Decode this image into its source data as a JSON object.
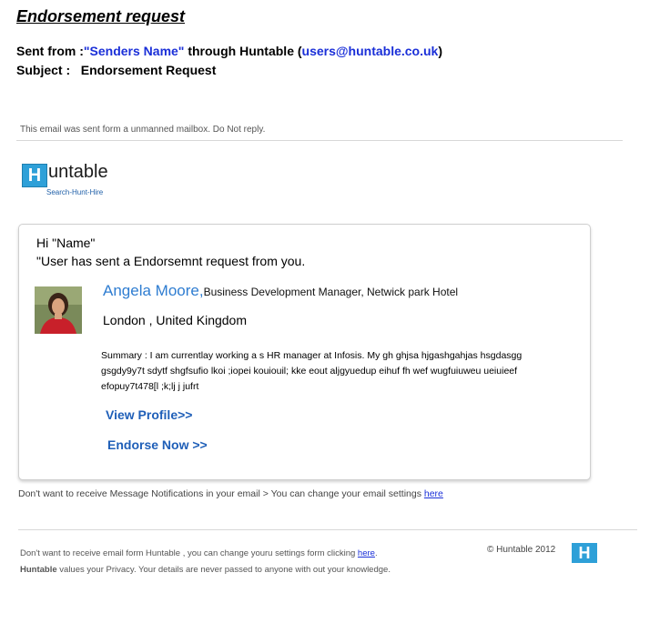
{
  "header": {
    "title": "Endorsement request",
    "sent_prefix": "Sent from :",
    "sender_name": "\"Senders Name\"",
    "sent_middle": " through Huntable (",
    "sender_email": "users@huntable.co.uk",
    "sent_suffix": ")",
    "subject_label": "Subject :",
    "subject_value": "Endorsement Request"
  },
  "notice": "This email was sent form a unmanned mailbox. Do Not reply.",
  "logo": {
    "mark": "H",
    "text": "untable",
    "tagline": "Search-Hunt-Hire"
  },
  "card": {
    "greeting": "Hi \"Name\"",
    "message": "\"User has sent a Endorsemnt request from you.",
    "person_name": "Angela Moore,",
    "person_title": "Business Development Manager, Netwick park Hotel",
    "location": "London , United Kingdom",
    "summary": "Summary :  I am currentlay working a s HR manager at Infosis. My gh ghjsa hjgashgahjas hsgdasgg gsgdy9y7t sdytf shgfsufio lkoi ;iopei kouiouil; kke eout aljgyuedup eihuf  fh wef wugfuiuweu  ueiuieef efopuy7t478[l  ;k;lj j jufrt",
    "view_profile": "View Profile>>",
    "endorse_now": "Endorse Now >>"
  },
  "notifications": {
    "text": "Don't want to receive Message Notifications in your email >  You can change your email settings ",
    "link": "here"
  },
  "footer": {
    "line1_text": "Don't want to receive email form Huntable , you can change youru settings form clicking ",
    "line1_link": "here",
    "line1_end": ".",
    "brand": "Huntable",
    "line2_text": " values your Privacy. Your details are never passed to anyone with out your knowledge.",
    "copyright": "© Huntable 2012",
    "badge": "H"
  },
  "colors": {
    "link_blue": "#1a2fd8",
    "name_blue": "#2f7dd1",
    "button_blue": "#1f5fb8",
    "brand_cyan": "#2ea0d8"
  }
}
